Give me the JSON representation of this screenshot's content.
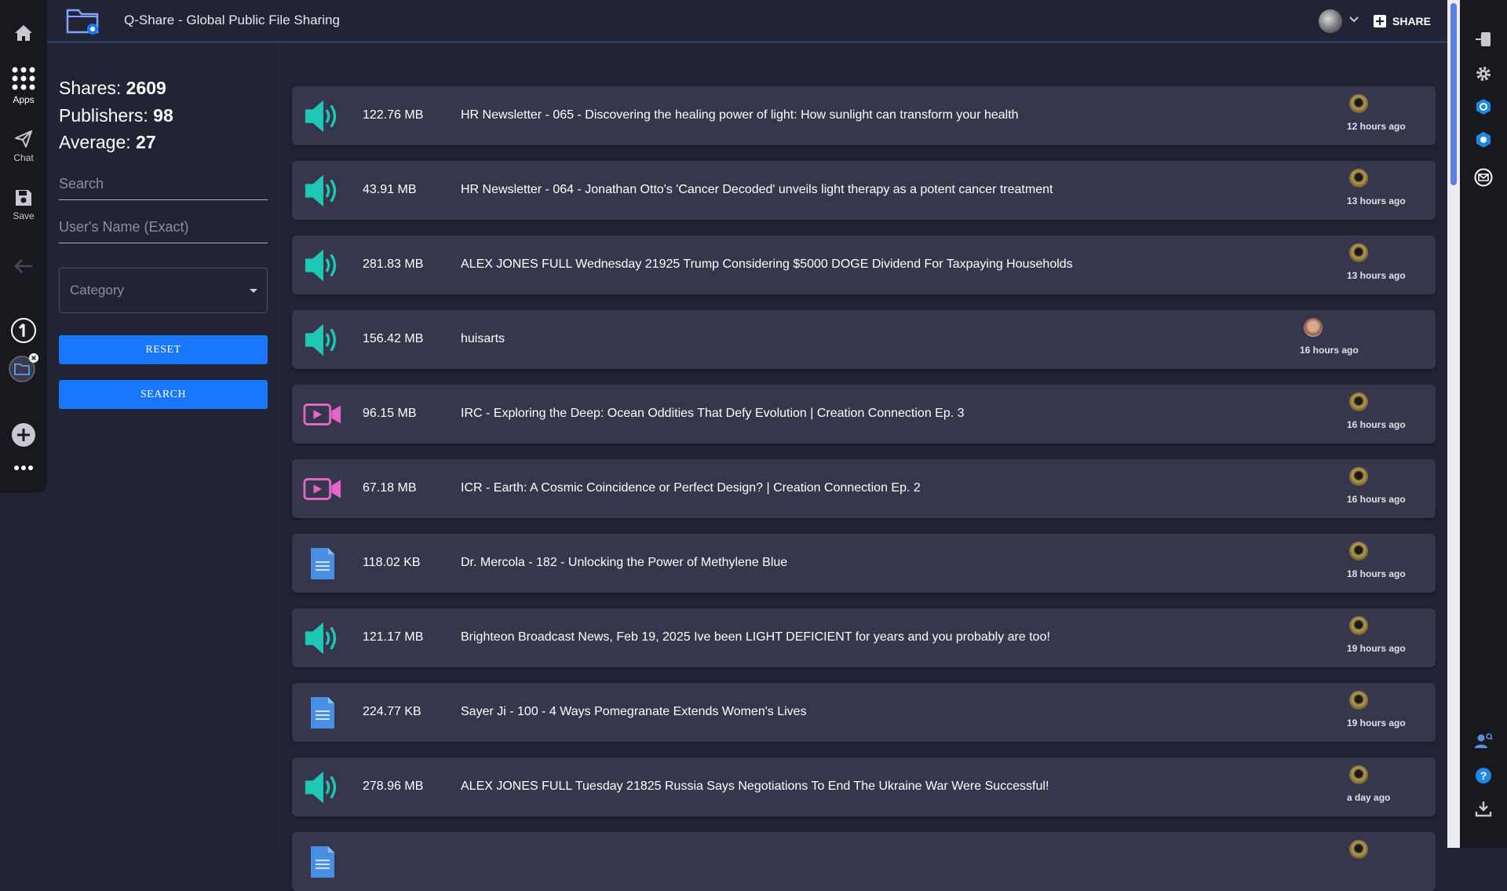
{
  "app": {
    "title": "Q-Share - Global Public File Sharing"
  },
  "left_nav": {
    "items": [
      {
        "icon": "home-icon",
        "label": ""
      },
      {
        "icon": "apps-grid-icon",
        "label": "Apps"
      },
      {
        "icon": "chat-icon",
        "label": "Chat"
      },
      {
        "icon": "save-icon",
        "label": "Save"
      }
    ]
  },
  "header": {
    "share_label": "SHARE"
  },
  "stats": {
    "shares_label": "Shares:",
    "shares_value": "2609",
    "publishers_label": "Publishers:",
    "publishers_value": "98",
    "average_label": "Average:",
    "average_value": "27"
  },
  "filters": {
    "search_placeholder": "Search",
    "username_placeholder": "User's Name (Exact)",
    "category_label": "Category",
    "reset_label": "RESET",
    "search_label": "SEARCH"
  },
  "files": [
    {
      "type": "audio",
      "size": "122.76 MB",
      "title": "HR Newsletter - 065 - Discovering the healing power of light: How sunlight can transform your health",
      "time": "12 hours ago",
      "avatar": "gold"
    },
    {
      "type": "audio",
      "size": "43.91 MB",
      "title": "HR Newsletter - 064 - Jonathan Otto's 'Cancer Decoded' unveils light therapy as a potent cancer treatment",
      "time": "13 hours ago",
      "avatar": "gold"
    },
    {
      "type": "audio",
      "size": "281.83 MB",
      "title": "ALEX JONES FULL Wednesday 21925 Trump Considering $5000 DOGE Dividend For Taxpaying Households",
      "time": "13 hours ago",
      "avatar": "gold"
    },
    {
      "type": "audio",
      "size": "156.42 MB",
      "title": "huisarts",
      "time": "16 hours ago",
      "avatar": "face"
    },
    {
      "type": "video",
      "size": "96.15 MB",
      "title": "IRC - Exploring the Deep: Ocean Oddities That Defy Evolution | Creation Connection Ep. 3",
      "time": "16 hours ago",
      "avatar": "gold"
    },
    {
      "type": "video",
      "size": "67.18 MB",
      "title": "ICR - Earth: A Cosmic Coincidence or Perfect Design? | Creation Connection Ep. 2",
      "time": "16 hours ago",
      "avatar": "gold"
    },
    {
      "type": "document",
      "size": "118.02 KB",
      "title": "Dr. Mercola - 182 - Unlocking the Power of Methylene Blue",
      "time": "18 hours ago",
      "avatar": "gold"
    },
    {
      "type": "audio",
      "size": "121.17 MB",
      "title": "Brighteon Broadcast News, Feb 19, 2025 Ive been LIGHT DEFICIENT for years and you probably are too!",
      "time": "19 hours ago",
      "avatar": "gold"
    },
    {
      "type": "document",
      "size": "224.77 KB",
      "title": "Sayer Ji - 100 - 4 Ways Pomegranate Extends Women's Lives",
      "time": "19 hours ago",
      "avatar": "gold"
    },
    {
      "type": "audio",
      "size": "278.96 MB",
      "title": "ALEX JONES FULL Tuesday 21825 Russia Says Negotiations To End The Ukraine War Were Successful!",
      "time": "a day ago",
      "avatar": "gold"
    },
    {
      "type": "document",
      "size": "",
      "title": "",
      "time": "",
      "avatar": "gold"
    }
  ],
  "colors": {
    "accent": "#1976ff",
    "audio": "#1ec8b4",
    "video": "#e466c8",
    "document": "#4a90e2"
  }
}
